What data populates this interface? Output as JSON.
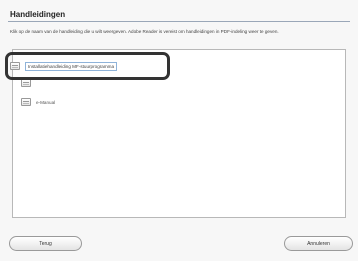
{
  "window": {
    "title": "Handleidingen",
    "instruction": "Klik op de naam van de handleiding die u wilt weergeven. Adobe Reader is vereist om handleidingen in PDF-indeling weer te geven."
  },
  "manuals": {
    "items": [
      {
        "label": "Installatiehandleiding MF-stuurprogramma",
        "icon": "document-icon",
        "selected": true
      },
      {
        "label": "",
        "icon": "document-icon",
        "selected": false
      },
      {
        "label": "e-Manual",
        "icon": "document-icon",
        "selected": false
      }
    ]
  },
  "buttons": {
    "back": "Terug",
    "cancel": "Annuleren"
  }
}
